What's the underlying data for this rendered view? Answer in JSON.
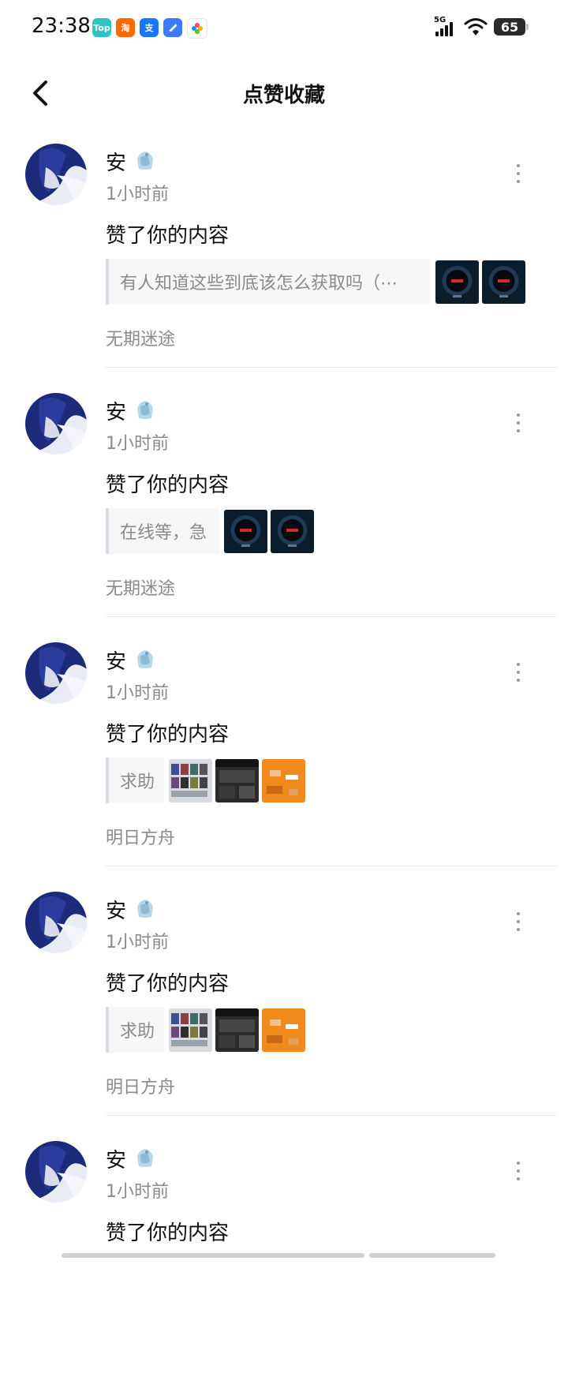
{
  "status_bar": {
    "time": "23:38",
    "apps": [
      {
        "label": "Top",
        "color": "#2ec5c1"
      },
      {
        "label": "淘",
        "color": "#ff6a00"
      },
      {
        "label": "支",
        "color": "#1677ff"
      },
      {
        "label": "",
        "color": "#3a7bff"
      },
      {
        "label": "",
        "color": "#ffffff"
      }
    ],
    "network": "5G",
    "battery": "65"
  },
  "header": {
    "title": "点赞收藏"
  },
  "items": [
    {
      "user": "安",
      "time": "1小时前",
      "action": "赞了你的内容",
      "quote": "有人知道这些到底该怎么获取吗（⋯",
      "source": "无期迷途",
      "thumb_type": "dark"
    },
    {
      "user": "安",
      "time": "1小时前",
      "action": "赞了你的内容",
      "quote": "在线等，急",
      "source": "无期迷途",
      "thumb_type": "dark"
    },
    {
      "user": "安",
      "time": "1小时前",
      "action": "赞了你的内容",
      "quote": "求助",
      "source": "明日方舟",
      "thumb_type": "mixed"
    },
    {
      "user": "安",
      "time": "1小时前",
      "action": "赞了你的内容",
      "quote": "求助",
      "source": "明日方舟",
      "thumb_type": "mixed"
    },
    {
      "user": "安",
      "time": "1小时前",
      "action": "赞了你的内容",
      "quote": "",
      "source": "",
      "thumb_type": "none"
    }
  ],
  "colors": {
    "secondary_text": "#8a8a8a",
    "quote_bg": "#f6f7f9",
    "divider": "#e8e8e8"
  }
}
